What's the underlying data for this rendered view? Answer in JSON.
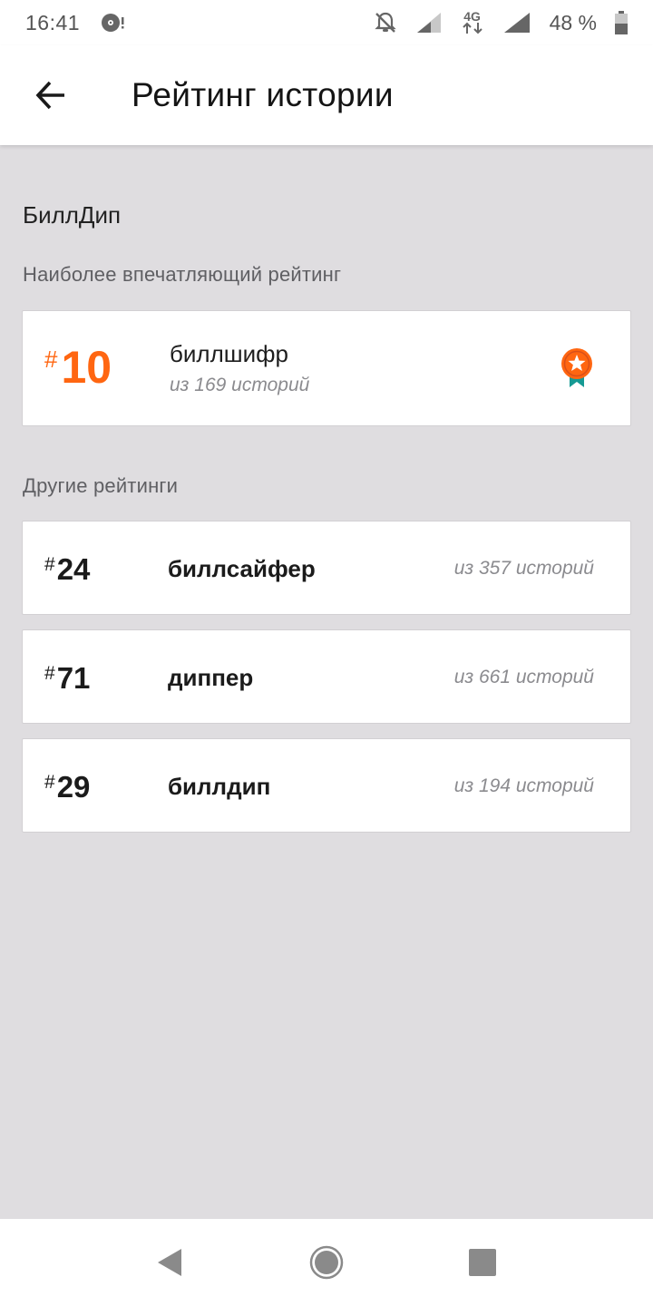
{
  "status_bar": {
    "time": "16:41",
    "network": "4G",
    "battery_percent": "48 %",
    "battery_level": 0.48,
    "icons": [
      "disc-notification-icon",
      "bell-off-icon",
      "signal-icon",
      "data-4g-icon",
      "signal-full-icon",
      "battery-icon"
    ]
  },
  "app_bar": {
    "title": "Рейтинг истории",
    "back_icon": "arrow-back-icon"
  },
  "story": {
    "name": "БиллДип"
  },
  "best_ranking": {
    "section_title": "Наиболее впечатляющий рейтинг",
    "hash": "#",
    "rank": "10",
    "tag": "биллшифр",
    "count": "из 169 историй",
    "badge_icon": "award-medal-icon",
    "accent_color": "#ff6611"
  },
  "other_rankings": {
    "section_title": "Другие рейтинги",
    "items": [
      {
        "hash": "#",
        "rank": "24",
        "tag": "биллсайфер",
        "count": "из 357 историй"
      },
      {
        "hash": "#",
        "rank": "71",
        "tag": "диппер",
        "count": "из 661 историй"
      },
      {
        "hash": "#",
        "rank": "29",
        "tag": "биллдип",
        "count": "из 194 историй"
      }
    ]
  },
  "nav_bar": {
    "icons": [
      "nav-back-icon",
      "nav-home-icon",
      "nav-recents-icon"
    ]
  }
}
